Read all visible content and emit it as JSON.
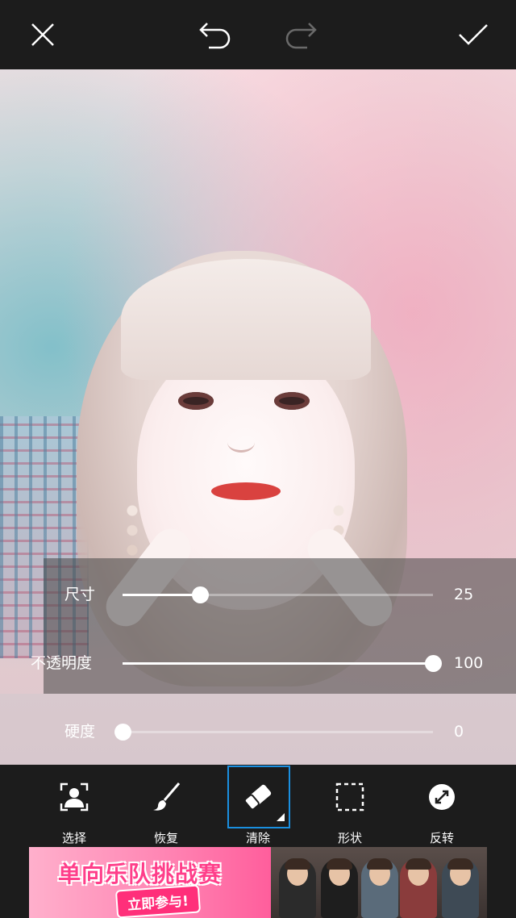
{
  "topbar": {
    "close_icon": "close-icon",
    "undo_icon": "undo-icon",
    "redo_icon": "redo-icon",
    "apply_icon": "checkmark-icon",
    "redo_enabled": false
  },
  "sliders": [
    {
      "label": "尺寸",
      "value": "25",
      "fraction": 0.25
    },
    {
      "label": "不透明度",
      "value": "100",
      "fraction": 1.0
    },
    {
      "label": "硬度",
      "value": "0",
      "fraction": 0.0
    }
  ],
  "tools": [
    {
      "label": "选择",
      "icon": "person-select-icon",
      "active": false
    },
    {
      "label": "恢复",
      "icon": "brush-icon",
      "active": false
    },
    {
      "label": "清除",
      "icon": "eraser-icon",
      "active": true
    },
    {
      "label": "形状",
      "icon": "dashed-square-icon",
      "active": false
    },
    {
      "label": "反转",
      "icon": "invert-icon",
      "active": false
    }
  ],
  "ad": {
    "title": "单向乐队挑战赛",
    "cta": "立即参与!"
  },
  "colors": {
    "background": "#1c1c1c",
    "accent": "#1a8fe0",
    "ad_pink": "#ff3e8a"
  }
}
